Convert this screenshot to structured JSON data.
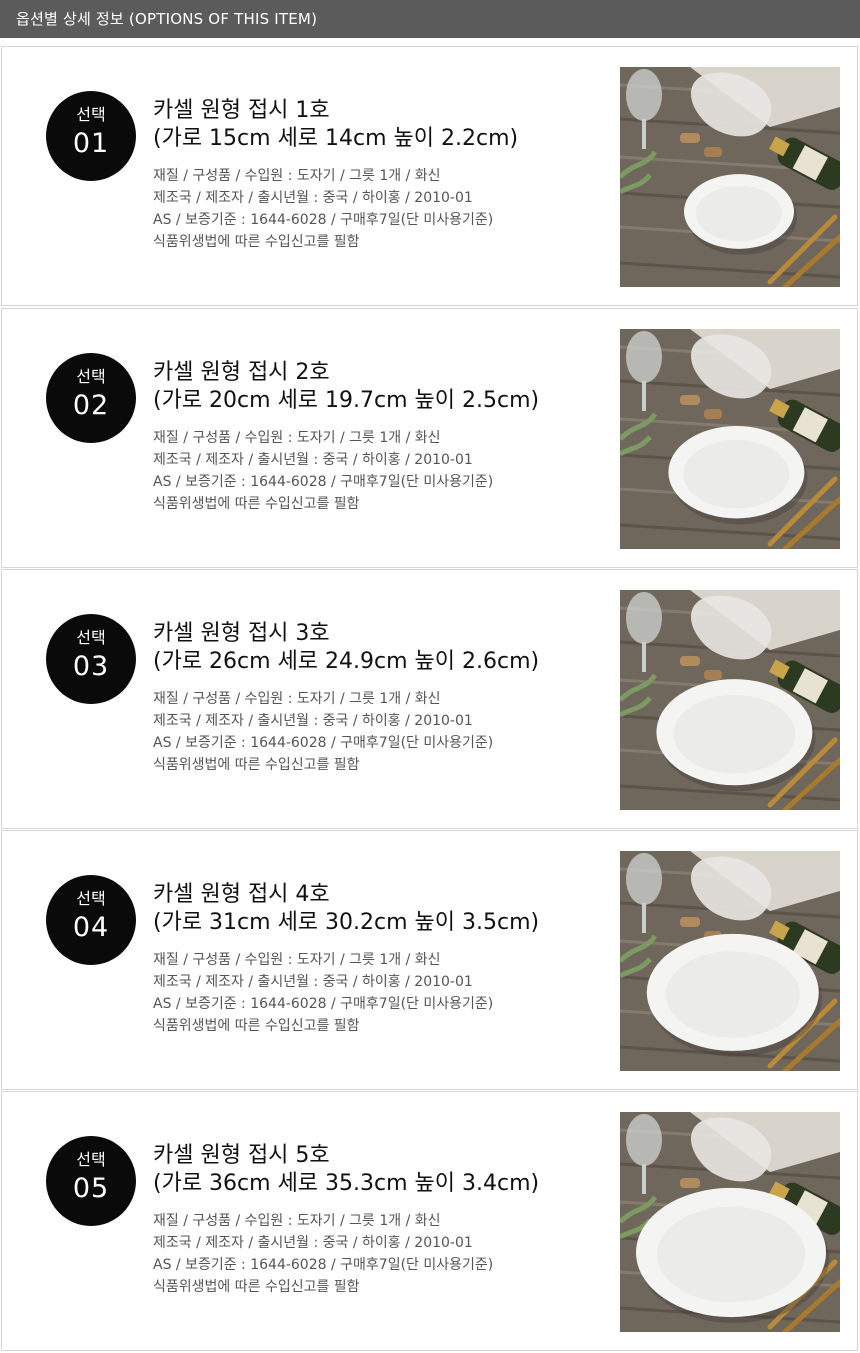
{
  "header": {
    "title": "옵션별 상세 정보 (OPTIONS OF THIS ITEM)"
  },
  "options": [
    {
      "badge_label": "선택",
      "number": "01",
      "title_line1": "카셀 원형 접시 1호",
      "title_line2": "(가로 15cm 세로 14cm 높이 2.2cm)",
      "specs": [
        "재질 / 구성품 / 수입원 : 도자기 / 그릇 1개 / 화신",
        "제조국 / 제조자 / 출시년월 : 중국 / 하이홍 / 2010-01",
        "AS / 보증기준 : 1644-6028 / 구매후7일(단 미사용기준)",
        "식품위생법에 따른 수입신고를 필함"
      ],
      "plate_scale": 0.55
    },
    {
      "badge_label": "선택",
      "number": "02",
      "title_line1": "카셀 원형 접시 2호",
      "title_line2": "(가로 20cm 세로 19.7cm 높이 2.5cm)",
      "specs": [
        "재질 / 구성품 / 수입원 : 도자기 / 그릇 1개 / 화신",
        "제조국 / 제조자 / 출시년월 : 중국 / 하이홍 / 2010-01",
        "AS / 보증기준 : 1644-6028 / 구매후7일(단 미사용기준)",
        "식품위생법에 따른 수입신고를 필함"
      ],
      "plate_scale": 0.68
    },
    {
      "badge_label": "선택",
      "number": "03",
      "title_line1": "카셀 원형 접시 3호",
      "title_line2": "(가로 26cm 세로 24.9cm 높이 2.6cm)",
      "specs": [
        "재질 / 구성품 / 수입원 : 도자기 / 그릇 1개 / 화신",
        "제조국 / 제조자 / 출시년월 : 중국 / 하이홍 / 2010-01",
        "AS / 보증기준 : 1644-6028 / 구매후7일(단 미사용기준)",
        "식품위생법에 따른 수입신고를 필함"
      ],
      "plate_scale": 0.78
    },
    {
      "badge_label": "선택",
      "number": "04",
      "title_line1": "카셀 원형 접시 4호",
      "title_line2": "(가로 31cm 세로 30.2cm 높이 3.5cm)",
      "specs": [
        "재질 / 구성품 / 수입원 : 도자기 / 그릇 1개 / 화신",
        "제조국 / 제조자 / 출시년월 : 중국 / 하이홍 / 2010-01",
        "AS / 보증기준 : 1644-6028 / 구매후7일(단 미사용기준)",
        "식품위생법에 따른 수입신고를 필함"
      ],
      "plate_scale": 0.86
    },
    {
      "badge_label": "선택",
      "number": "05",
      "title_line1": "카셀 원형 접시 5호",
      "title_line2": "(가로 36cm 세로 35.3cm 높이 3.4cm)",
      "specs": [
        "재질 / 구성품 / 수입원 : 도자기 / 그릇 1개 / 화신",
        "제조국 / 제조자 / 출시년월 : 중국 / 하이홍 / 2010-01",
        "AS / 보증기준 : 1644-6028 / 구매후7일(단 미사용기준)",
        "식품위생법에 따른 수입신고를 필함"
      ],
      "plate_scale": 0.95
    }
  ]
}
